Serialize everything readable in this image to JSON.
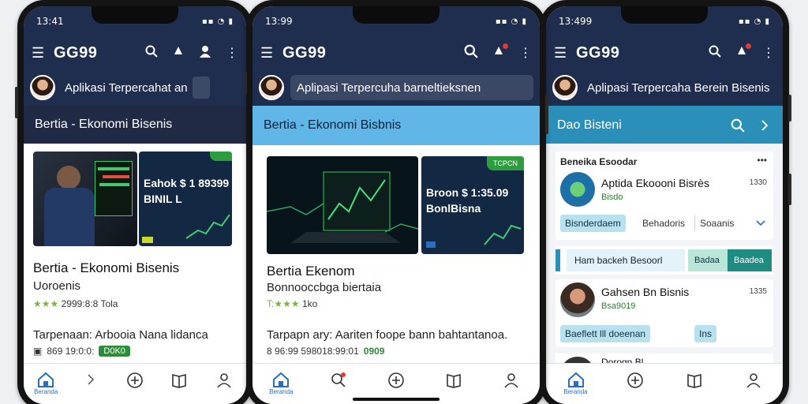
{
  "colors": {
    "header_navy": "#1f2d4e",
    "section_dark": "#202a45",
    "section_light_blue": "#5fb6e7",
    "section_teal": "#2a8fb9",
    "accent_green": "#2e9d3f",
    "nav_blue": "#2a6fbd"
  },
  "phones": [
    {
      "status_time": "13:41",
      "app_title": "GG99",
      "search_text": "Aplikasi Terpercahat an",
      "search_suffix": "an",
      "section_title": "Bertia - Ekonomi Bisenis",
      "promo": {
        "tag": "",
        "line1": "Eahok $ 1 89399",
        "line2": "BINIL L",
        "badge": ""
      },
      "news_title": "Bertia - Ekonomi Bisenis",
      "news_sub": "Uoroenis",
      "rating_stars": "★★★",
      "rating_text": "2999:8:8 Tola",
      "tagline": "Tarpenaan: Arbooia Nana lidanca",
      "meta_text": "869 19:0:0:",
      "meta_badge": "D0K0",
      "nav": [
        {
          "icon": "home-icon",
          "label": "Beranda"
        },
        {
          "icon": "chevron-right-icon",
          "label": ""
        },
        {
          "icon": "plus-circle-icon",
          "label": ""
        },
        {
          "icon": "book-icon",
          "label": ""
        },
        {
          "icon": "user-icon",
          "label": ""
        }
      ]
    },
    {
      "status_time": "13:99",
      "app_title": "GG99",
      "search_text": "Aplipasi Terpercuha barneltieksnen",
      "section_title": "Bertia - Ekonomi Bisbnis",
      "promo": {
        "tag": "TCPCN",
        "line1": "Broon $ 1:35.09",
        "line2": "BonlBisna"
      },
      "news_title": "Bertia Ekenom",
      "news_sub": "Bonnooccbga biertaia",
      "rating_stars": "T:★★★",
      "rating_text": "1ko",
      "tagline": "Tarpapn ary: Aariten foope bann bahtantanoa.",
      "meta_text": "8 96:99 598018:99:01",
      "meta_badge": "0909",
      "nav": [
        {
          "icon": "home-icon",
          "label": "Beranda"
        },
        {
          "icon": "search-icon",
          "label": ""
        },
        {
          "icon": "plus-circle-icon",
          "label": ""
        },
        {
          "icon": "book-icon",
          "label": ""
        },
        {
          "icon": "user-icon",
          "label": ""
        }
      ]
    },
    {
      "status_time": "13:499",
      "app_title": "GG99",
      "search_text": "Aplipasi Terpercaha Berein Bisenis",
      "section_title": "Dao Bisteni",
      "list_header": "Beneika Esoodar",
      "list_more": "•••",
      "item1": {
        "name": "Aptida Ekoooni Bisrès",
        "sub": "Bisdo",
        "num": "1330"
      },
      "chips1": [
        "Bisnderdaem",
        "Behadoris",
        "Soaanis"
      ],
      "band_left": "Ham backeh Besoorl",
      "band_mid": "Badaa",
      "band_right": "Baadea",
      "item2": {
        "name": "Gahsen Bn Bisnis",
        "sub": "Bsa9019",
        "num": "1335"
      },
      "chips2": [
        "Baeflett lll doeenan",
        "Ins"
      ],
      "item3_name": "Dorogn Bl",
      "nav": [
        {
          "icon": "home-icon",
          "label": "Beranda"
        },
        {
          "icon": "plus-circle-icon",
          "label": ""
        },
        {
          "icon": "book-icon",
          "label": ""
        },
        {
          "icon": "user-icon",
          "label": ""
        }
      ]
    }
  ]
}
